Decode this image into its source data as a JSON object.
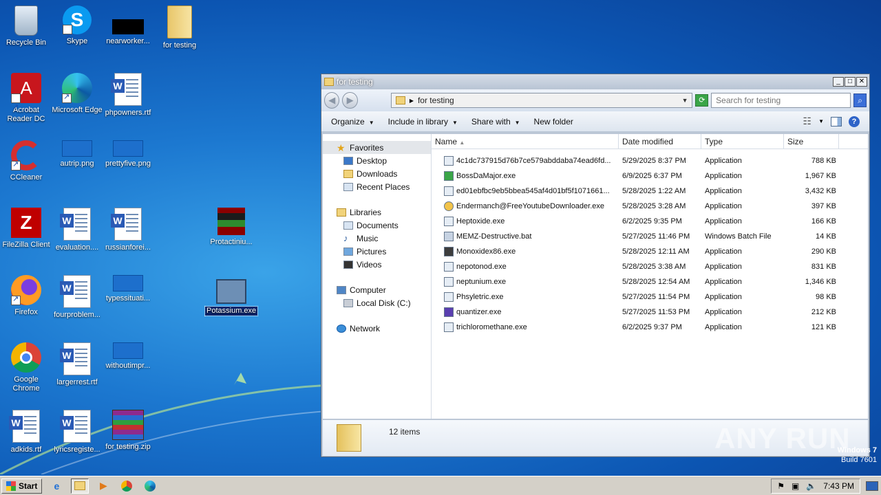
{
  "desktop": {
    "icons": [
      {
        "label": "Recycle Bin",
        "icon": "recycle-bin-icon"
      },
      {
        "label": "Skype",
        "icon": "skype-icon"
      },
      {
        "label": "nearworker...",
        "icon": "black-image-icon"
      },
      {
        "label": "for testing",
        "icon": "folder-icon"
      },
      {
        "label": "Acrobat Reader DC",
        "icon": "acrobat-icon"
      },
      {
        "label": "Microsoft Edge",
        "icon": "edge-icon"
      },
      {
        "label": "phpowners.rtf",
        "icon": "word-doc-icon"
      },
      {
        "label": "CCleaner",
        "icon": "ccleaner-icon"
      },
      {
        "label": "autrip.png",
        "icon": "image-icon"
      },
      {
        "label": "prettyfive.png",
        "icon": "image-icon"
      },
      {
        "label": "FileZilla Client",
        "icon": "filezilla-icon"
      },
      {
        "label": "evaluation....",
        "icon": "word-doc-icon"
      },
      {
        "label": "russianforei...",
        "icon": "word-doc-icon"
      },
      {
        "label": "Protactiniu...",
        "icon": "pixel-character-icon"
      },
      {
        "label": "Firefox",
        "icon": "firefox-icon"
      },
      {
        "label": "fourproblem...",
        "icon": "word-doc-icon"
      },
      {
        "label": "typessituati...",
        "icon": "image-icon"
      },
      {
        "label": "Potassium.exe",
        "icon": "application-icon"
      },
      {
        "label": "Google Chrome",
        "icon": "chrome-icon"
      },
      {
        "label": "largerrest.rtf",
        "icon": "word-doc-icon"
      },
      {
        "label": "withoutimpr...",
        "icon": "image-icon"
      },
      {
        "label": "adkids.rtf",
        "icon": "word-doc-icon"
      },
      {
        "label": "lyricsregiste...",
        "icon": "word-doc-icon"
      },
      {
        "label": "for testing.zip",
        "icon": "winrar-icon"
      }
    ]
  },
  "window": {
    "title": "for testing",
    "address": "for testing",
    "search_placeholder": "Search for testing",
    "toolbar": {
      "organize": "Organize",
      "include": "Include in library",
      "share": "Share with",
      "new_folder": "New folder"
    },
    "nav": {
      "favorites": "Favorites",
      "desktop": "Desktop",
      "downloads": "Downloads",
      "recent": "Recent Places",
      "libraries": "Libraries",
      "documents": "Documents",
      "music": "Music",
      "pictures": "Pictures",
      "videos": "Videos",
      "computer": "Computer",
      "local_disk": "Local Disk (C:)",
      "network": "Network"
    },
    "columns": {
      "name": "Name",
      "date": "Date modified",
      "type": "Type",
      "size": "Size"
    },
    "files": [
      {
        "name": "4c1dc737915d76b7ce579abddaba74ead6fd...",
        "date": "5/29/2025 8:37 PM",
        "type": "Application",
        "size": "788 KB"
      },
      {
        "name": "BossDaMajor.exe",
        "date": "6/9/2025 6:37 PM",
        "type": "Application",
        "size": "1,967 KB"
      },
      {
        "name": "ed01ebfbc9eb5bbea545af4d01bf5f1071661...",
        "date": "5/28/2025 1:22 AM",
        "type": "Application",
        "size": "3,432 KB"
      },
      {
        "name": "Endermanch@FreeYoutubeDownloader.exe",
        "date": "5/28/2025 3:28 AM",
        "type": "Application",
        "size": "397 KB"
      },
      {
        "name": "Heptoxide.exe",
        "date": "6/2/2025 9:35 PM",
        "type": "Application",
        "size": "166 KB"
      },
      {
        "name": "MEMZ-Destructive.bat",
        "date": "5/27/2025 11:46 PM",
        "type": "Windows Batch File",
        "size": "14 KB"
      },
      {
        "name": "Monoxidex86.exe",
        "date": "5/28/2025 12:11 AM",
        "type": "Application",
        "size": "290 KB"
      },
      {
        "name": "nepotonod.exe",
        "date": "5/28/2025 3:38 AM",
        "type": "Application",
        "size": "831 KB"
      },
      {
        "name": "neptunium.exe",
        "date": "5/28/2025 12:54 AM",
        "type": "Application",
        "size": "1,346 KB"
      },
      {
        "name": "Phsyletric.exe",
        "date": "5/27/2025 11:54 PM",
        "type": "Application",
        "size": "98 KB"
      },
      {
        "name": "quantizer.exe",
        "date": "5/27/2025 11:53 PM",
        "type": "Application",
        "size": "212 KB"
      },
      {
        "name": "trichloromethane.exe",
        "date": "6/2/2025 9:37 PM",
        "type": "Application",
        "size": "121 KB"
      }
    ],
    "status": "12 items"
  },
  "watermark": "ANY RUN",
  "os": {
    "line1": "Windows 7",
    "line2": "Build 7601"
  },
  "taskbar": {
    "start": "Start",
    "time": "7:43 PM"
  }
}
